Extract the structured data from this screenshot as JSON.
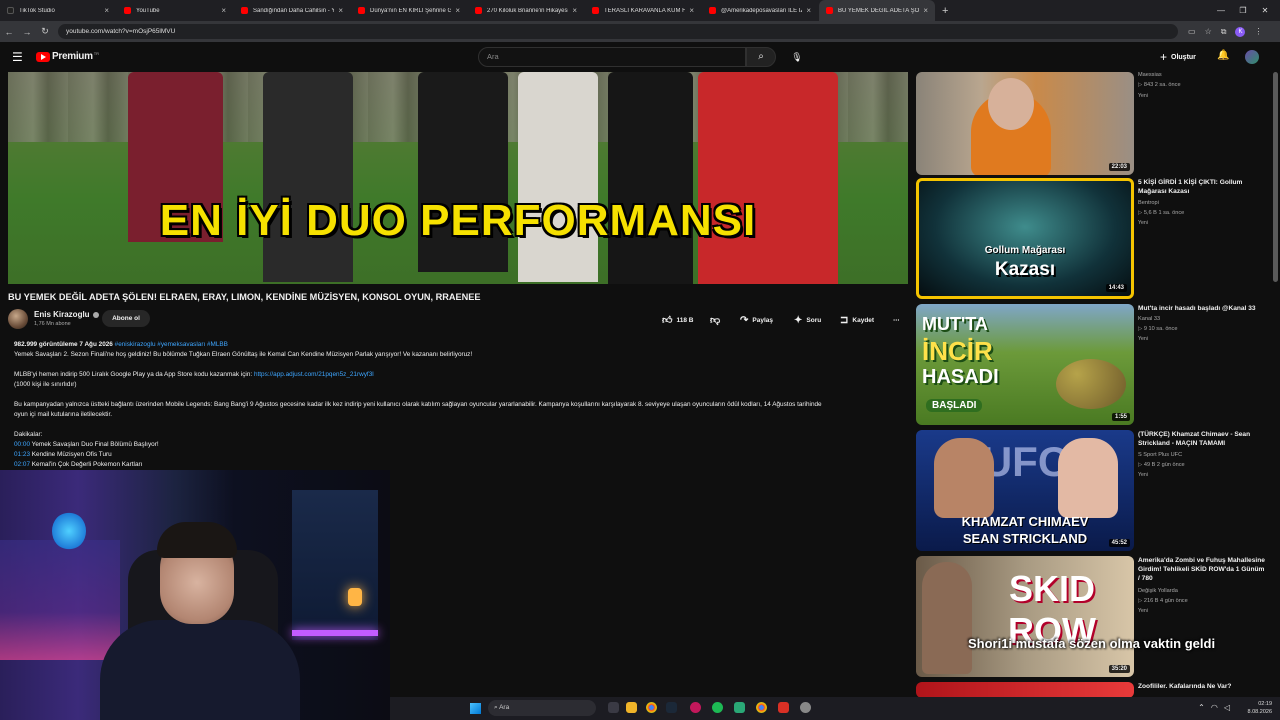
{
  "browser": {
    "tabs": [
      {
        "label": "TikTok Studio",
        "active": false
      },
      {
        "label": "YouTube",
        "active": false
      },
      {
        "label": "Sandığından Daha Cahilsin - Yo",
        "active": false
      },
      {
        "label": "Dünya'nın EN KİRLİ Şehrine Gir",
        "active": false
      },
      {
        "label": "270 Kiloluk Brianne'in Hikayesi",
        "active": false
      },
      {
        "label": "TERASLI KARAVANLA KUM FIRT",
        "active": false
      },
      {
        "label": "@Amerikadeposavasları İLE İZN",
        "active": false
      },
      {
        "label": "BU YEMEK DEĞİL ADETA ŞÖLEN",
        "active": true
      }
    ],
    "url": "youtube.com/watch?v=mOsjP65lMVU",
    "profile_initial": "K"
  },
  "youtube": {
    "logo_text": "Premium",
    "logo_region": "TR",
    "search_placeholder": "Ara",
    "create_label": "Oluştur"
  },
  "video": {
    "overlay_text": "EN İYİ DUO PERFORMANSI",
    "title": "BU YEMEK DEĞİL ADETA ŞÖLEN! ELRAEN, ERAY, LIMON, KENDİNE MÜZİSYEN, KONSOL OYUN, RRAENEE",
    "channel": "Enis Kirazoglu",
    "subscribers": "1,76 Mn abone",
    "subscribe_label": "Abone ol",
    "likes": "118 B",
    "share_label": "Paylaş",
    "ask_label": "Soru",
    "save_label": "Kaydet",
    "more_label": "⋯"
  },
  "description": {
    "meta": "982.999 görüntüleme  7 Ağu 2026",
    "tags": "#eniskirazoglu #yemeksavasları #MLBB",
    "line1": "Yemek Savaşları 2. Sezon Finali'ne hoş geldiniz! Bu bölümde Tuğkan Elraen Gönültaş ile Kemal Can Kendine Müzisyen Parlak yarışıyor! Ve kazananı belirliyoruz!",
    "line2": "MLBB'yi hemen indirip 500 Liralık Google Play ya da App Store kodu kazanmak için:",
    "link": "https://app.adjust.com/21pqen5z_21rwyf3l",
    "line3": "(1000 kişi ile sınırlıdır)",
    "line4": "Bu kampanyadan yalnızca üstteki bağlantı üzerinden Mobile Legends: Bang Bang'i 9 Ağustos gecesine kadar ilk kez indirip yeni kullanıcı olarak katılım sağlayan oyuncular yararlanabilir. Kampanya koşullarını karşılayarak 8. seviyeye ulaşan oyuncuların ödül kodları, 14 Ağustos tarihinde",
    "line5": "oyun içi mail kutularına iletilecektir.",
    "chapters_label": "Dakikalar:",
    "chapters": [
      {
        "time": "00:00",
        "label": "Yemek Savaşları Duo Final Bölümü Başlıyor!"
      },
      {
        "time": "01:23",
        "label": "Kendine Müzisyen Ofis Turu"
      },
      {
        "time": "02:07",
        "label": "Kemal'in Çok Değerli Pokemon Kartları"
      }
    ]
  },
  "recommendations": [
    {
      "title": "",
      "channel": "Maessias",
      "views": "▷ 843   2 sa. önce",
      "badge": "Yeni",
      "duration": "22:03"
    },
    {
      "title": "5 KİŞİ GİRDİ 1 KİŞİ ÇIKTI: Gollum Mağarası Kazası",
      "channel": "Bentropi",
      "views": "▷ 5,6 B   1 sa. önce",
      "badge": "Yeni",
      "duration": "14:43",
      "thumb_text_1": "Gollum Mağarası",
      "thumb_text_2": "Kazası"
    },
    {
      "title": "Mut'ta incir hasadı başladı @Kanal 33",
      "channel": "Kanal 33",
      "views": "▷ 9   10 sa. önce",
      "badge": "Yeni",
      "duration": "1:55",
      "thumb_text_1": "MUT'TA",
      "thumb_text_2": "İNCİR",
      "thumb_text_3": "HASADI",
      "thumb_text_4": "BAŞLADI"
    },
    {
      "title": "(TÜRKÇE) Khamzat Chimaev - Sean Strickland - MAÇIN TAMAMI",
      "channel": "S Sport Plus UFC",
      "views": "▷ 49 B   2 gün önce",
      "badge": "Yeni",
      "duration": "45:52",
      "thumb_text_1": "UFC",
      "thumb_text_2": "KHAMZAT CHIMAEV",
      "thumb_text_3": "SEAN STRICKLAND"
    },
    {
      "title": "Amerika'da Zombi ve Fuhuş Mahallesine Girdim! Tehlikeli SKİD ROW'da 1 Günüm / 780",
      "channel": "Değişik Yollarda",
      "views": "▷ 216 B   4 gün önce",
      "badge": "Yeni",
      "duration": "35:20",
      "thumb_text_1": "SKID ROW"
    },
    {
      "title": "Zoofililer. Kafalarında Ne Var?",
      "channel": "",
      "views": "",
      "badge": "",
      "duration": ""
    }
  ],
  "chat_overlay": "Shori1i  mustafa sözen olma vaktin geldi",
  "taskbar": {
    "search": "Ara",
    "time": "02:19",
    "date": "8.08.2026"
  }
}
